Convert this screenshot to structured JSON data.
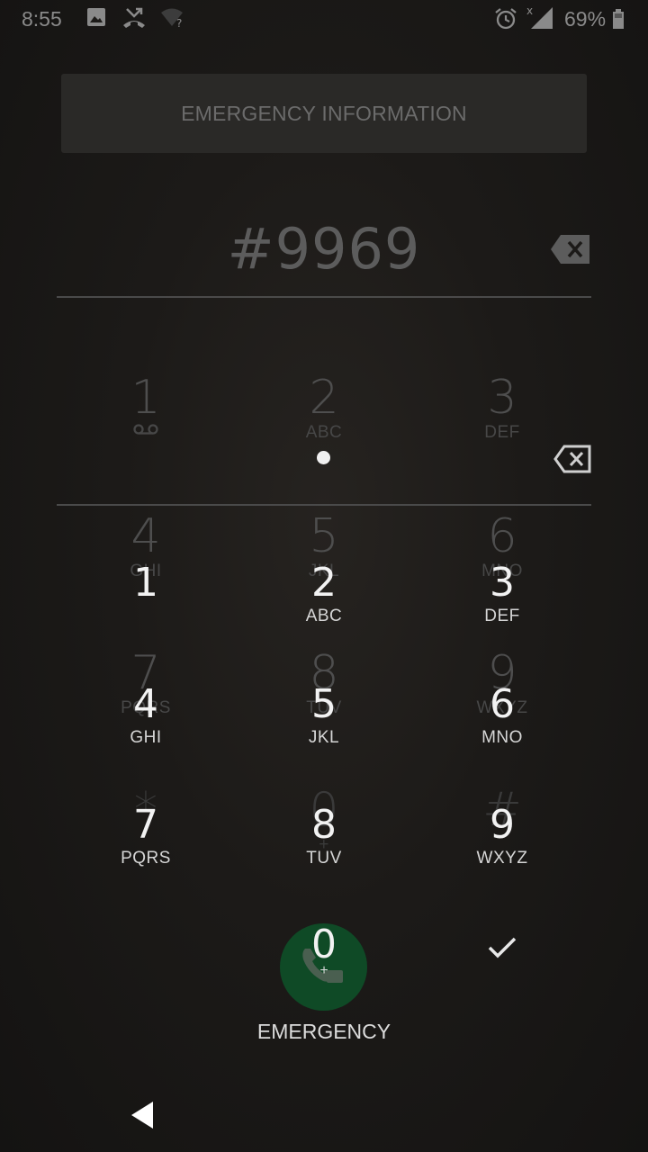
{
  "status_bar": {
    "time": "8:55",
    "battery": "69%",
    "icons": [
      "image-icon",
      "missed-call-icon",
      "wifi-unknown-icon",
      "alarm-icon",
      "signal-icon",
      "battery-icon"
    ]
  },
  "emergency_info_button": "EMERGENCY INFORMATION",
  "dialer": {
    "entered_digits": "#9969"
  },
  "ghost_keypad": [
    {
      "num": "1",
      "letters": ""
    },
    {
      "num": "2",
      "letters": "ABC"
    },
    {
      "num": "3",
      "letters": "DEF"
    },
    {
      "num": "4",
      "letters": "GHI"
    },
    {
      "num": "5",
      "letters": "JKL"
    },
    {
      "num": "6",
      "letters": "MNO"
    },
    {
      "num": "7",
      "letters": "PQRS"
    },
    {
      "num": "8",
      "letters": "TUV"
    },
    {
      "num": "9",
      "letters": "WXYZ"
    },
    {
      "num": "*",
      "letters": ""
    },
    {
      "num": "0",
      "letters": "+"
    },
    {
      "num": "#",
      "letters": ""
    }
  ],
  "keypad": [
    {
      "num": "1",
      "letters": ""
    },
    {
      "num": "2",
      "letters": "ABC"
    },
    {
      "num": "3",
      "letters": "DEF"
    },
    {
      "num": "4",
      "letters": "GHI"
    },
    {
      "num": "5",
      "letters": "JKL"
    },
    {
      "num": "6",
      "letters": "MNO"
    },
    {
      "num": "7",
      "letters": "PQRS"
    },
    {
      "num": "8",
      "letters": "TUV"
    },
    {
      "num": "9",
      "letters": "WXYZ"
    }
  ],
  "zero_key": {
    "num": "0",
    "letters": "+"
  },
  "call_label": "EMERGENCY",
  "colors": {
    "call_button": "#0f4a26",
    "background": "#1c1a18"
  }
}
